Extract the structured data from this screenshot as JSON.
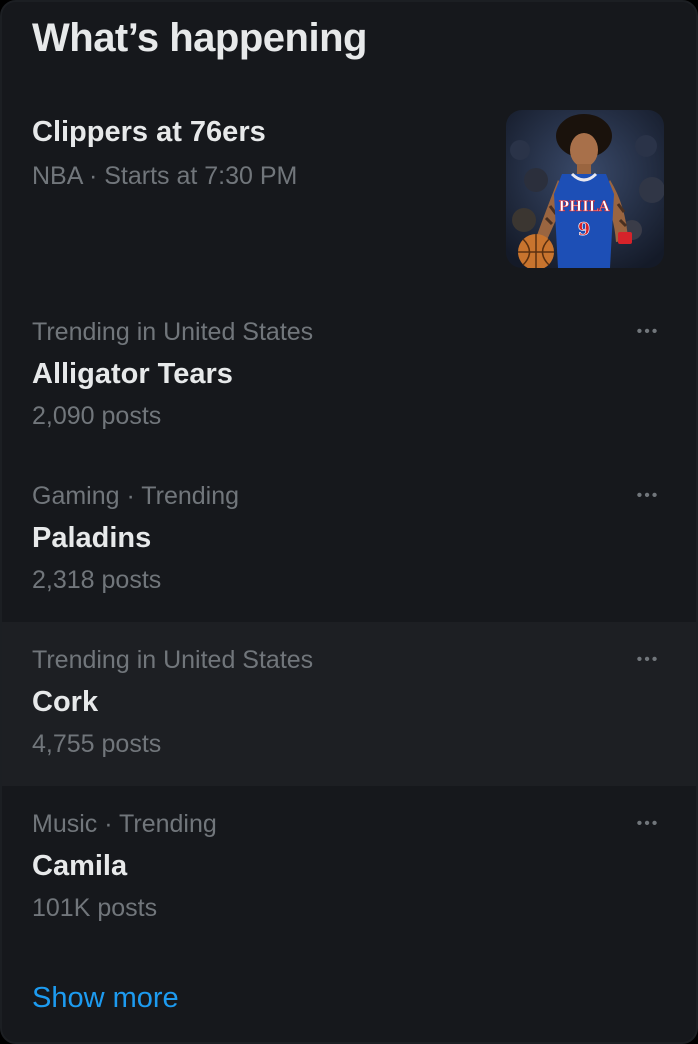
{
  "header": {
    "title": "What’s happening"
  },
  "event": {
    "title": "Clippers at 76ers",
    "meta": "NBA · Starts at 7:30 PM",
    "jersey_text": "PHILA",
    "jersey_number": "9"
  },
  "trends": [
    {
      "context": "Trending in United States",
      "name": "Alligator Tears",
      "count": "2,090 posts",
      "more_glyph": "•••"
    },
    {
      "context": "Gaming · Trending",
      "name": "Paladins",
      "count": "2,318 posts",
      "more_glyph": "•••"
    },
    {
      "context": "Trending in United States",
      "name": "Cork",
      "count": "4,755 posts",
      "more_glyph": "•••"
    },
    {
      "context": "Music · Trending",
      "name": "Camila",
      "count": "101K posts",
      "more_glyph": "•••"
    }
  ],
  "footer": {
    "show_more": "Show more"
  },
  "colors": {
    "background": "#16181c",
    "hover_row": "#1d1f23",
    "primary_text": "#e7e9ea",
    "secondary_text": "#71767b",
    "link": "#1d9bf0"
  },
  "icons": {
    "more": "more-horizontal-icon"
  }
}
